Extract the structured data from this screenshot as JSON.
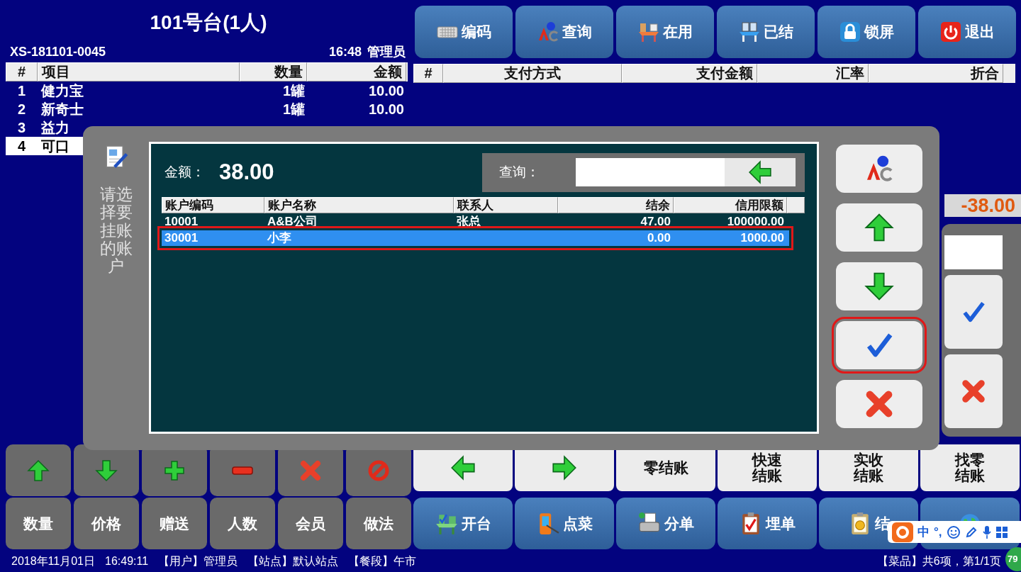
{
  "order": {
    "table_title": "101号台(1人)",
    "order_no": "XS-181101-0045",
    "time": "16:48",
    "operator": "管理员",
    "columns": [
      "#",
      "项目",
      "数量",
      "金额"
    ],
    "rows": [
      {
        "no": "1",
        "item": "健力宝",
        "qty": "1罐",
        "amount": "10.00",
        "selected": false
      },
      {
        "no": "2",
        "item": "新奇士",
        "qty": "1罐",
        "amount": "10.00",
        "selected": false
      },
      {
        "no": "3",
        "item": "益力",
        "selected": false
      },
      {
        "no": "4",
        "item": "可口",
        "selected": true
      }
    ]
  },
  "top_buttons": [
    {
      "label": "编码"
    },
    {
      "label": "查询"
    },
    {
      "label": "在用"
    },
    {
      "label": "已结"
    },
    {
      "label": "锁屏"
    },
    {
      "label": "退出"
    }
  ],
  "payments": {
    "columns": [
      "#",
      "支付方式",
      "支付金额",
      "汇率",
      "折合"
    ]
  },
  "balance": "-38.00",
  "edit_buttons": [
    {
      "kind": "icon"
    },
    {
      "kind": "icon"
    },
    {
      "kind": "icon"
    },
    {
      "kind": "icon"
    },
    {
      "kind": "icon"
    },
    {
      "kind": "icon"
    }
  ],
  "settle_buttons": [
    {
      "kind": "icon"
    },
    {
      "kind": "icon"
    },
    {
      "kind": "text",
      "label": "零结账"
    },
    {
      "kind": "stacked",
      "label": "快速结账"
    },
    {
      "kind": "stacked",
      "label": "实收结账"
    },
    {
      "kind": "stacked",
      "label": "找零结账"
    }
  ],
  "attr_buttons": [
    {
      "label": "数量"
    },
    {
      "label": "价格"
    },
    {
      "label": "赠送"
    },
    {
      "label": "人数"
    },
    {
      "label": "会员"
    },
    {
      "label": "做法"
    }
  ],
  "nav_buttons": [
    {
      "kind": "text",
      "label": "开台"
    },
    {
      "kind": "text",
      "label": "点菜"
    },
    {
      "kind": "text",
      "label": "分单"
    },
    {
      "kind": "text",
      "label": "埋单"
    },
    {
      "kind": "text",
      "label": "结"
    },
    {
      "kind": "icon"
    }
  ],
  "status_bar": {
    "left": [
      "2018年11月01日",
      "16:49:11",
      "【用户】管理员",
      "【站点】默认站点",
      "【餐段】午市"
    ],
    "right": "【菜品】共6项，第1/1页"
  },
  "dialog": {
    "prompt": "请选择要挂账的账户",
    "amount_label": "金额：",
    "amount": "38.00",
    "search_label": "查询：",
    "columns": [
      "账户编码",
      "账户名称",
      "联系人",
      "结余",
      "信用限额"
    ],
    "accounts": [
      {
        "code": "10001",
        "name": "A&B公司",
        "contact": "张总",
        "balance": "47.00",
        "limit": "100000.00",
        "selected": false,
        "highlighted": false
      },
      {
        "code": "30001",
        "name": "小李",
        "balance": "0.00",
        "limit": "1000.00",
        "selected": true,
        "highlighted": true
      }
    ],
    "buttons": [
      {
        "highlighted": false
      },
      {
        "highlighted": false
      },
      {
        "highlighted": false
      },
      {
        "highlighted": true
      },
      {
        "highlighted": false
      }
    ]
  },
  "ime_toolbar": {
    "mode": "中",
    "punct": "°,"
  },
  "corner_badge": "79"
}
